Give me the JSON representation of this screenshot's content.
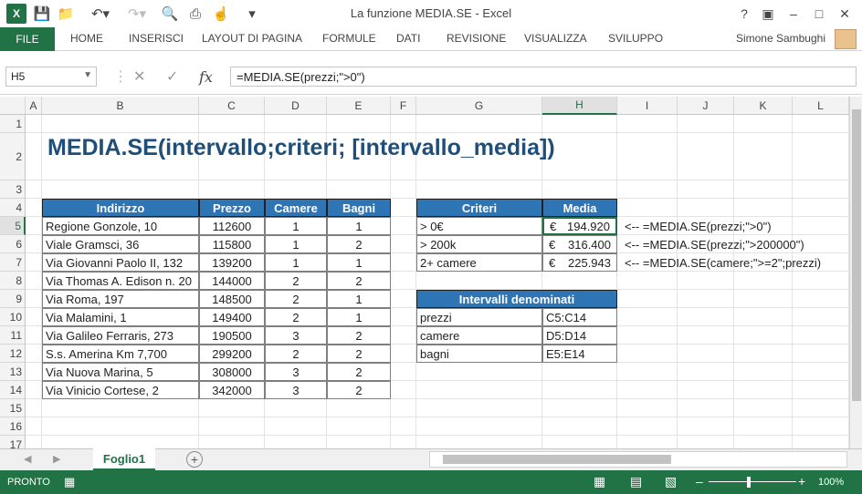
{
  "window": {
    "title": "La funzione MEDIA.SE - Excel",
    "app_icon": "X"
  },
  "ribbon": {
    "file": "FILE",
    "tabs": [
      "HOME",
      "INSERISCI",
      "LAYOUT DI PAGINA",
      "FORMULE",
      "DATI",
      "REVISIONE",
      "VISUALIZZA",
      "SVILUPPO"
    ],
    "user": "Simone Sambughi"
  },
  "formula_bar": {
    "name_box": "H5",
    "formula": "=MEDIA.SE(prezzi;\">0\")",
    "fx": "fx"
  },
  "columns": [
    "A",
    "B",
    "C",
    "D",
    "E",
    "F",
    "G",
    "H",
    "I",
    "J",
    "K",
    "L"
  ],
  "rows": [
    "1",
    "2",
    "3",
    "4",
    "5",
    "6",
    "7",
    "8",
    "9",
    "10",
    "11",
    "12",
    "13",
    "14",
    "15",
    "16",
    "17"
  ],
  "sheet": {
    "title": "MEDIA.SE(intervallo;criteri; [intervallo_media])",
    "table_headers": [
      "Indirizzo",
      "Prezzo",
      "Camere",
      "Bagni"
    ],
    "table_rows": [
      [
        "Regione Gonzole, 10",
        "112600",
        "1",
        "1"
      ],
      [
        "Viale Gramsci, 36",
        "115800",
        "1",
        "2"
      ],
      [
        "Via Giovanni Paolo II, 132",
        "139200",
        "1",
        "1"
      ],
      [
        "Via Thomas A. Edison n. 20",
        "144000",
        "2",
        "2"
      ],
      [
        "Via Roma, 197",
        "148500",
        "2",
        "1"
      ],
      [
        "Via Malamini, 1",
        "149400",
        "2",
        "1"
      ],
      [
        "Via Galileo Ferraris, 273",
        "190500",
        "3",
        "2"
      ],
      [
        "S.s. Amerina Km 7,700",
        "299200",
        "2",
        "2"
      ],
      [
        "Via Nuova Marina, 5",
        "308000",
        "3",
        "2"
      ],
      [
        "Via Vinicio Cortese, 2",
        "342000",
        "3",
        "2"
      ]
    ],
    "criteria_headers": [
      "Criteri",
      "Media"
    ],
    "criteria_rows": [
      {
        "label": "> 0€",
        "currency": "€",
        "value": "194.920",
        "note": "<-- =MEDIA.SE(prezzi;\">0\")"
      },
      {
        "label": "> 200k",
        "currency": "€",
        "value": "316.400",
        "note": "<-- =MEDIA.SE(prezzi;\">200000\")"
      },
      {
        "label": "2+ camere",
        "currency": "€",
        "value": "225.943",
        "note": "<-- =MEDIA.SE(camere;\">=2\";prezzi)"
      }
    ],
    "named_header": "Intervalli denominati",
    "named_rows": [
      [
        "prezzi",
        "C5:C14"
      ],
      [
        "camere",
        "D5:D14"
      ],
      [
        "bagni",
        "E5:E14"
      ]
    ]
  },
  "sheet_tab": "Foglio1",
  "status": {
    "ready": "PRONTO",
    "zoom": "100%"
  },
  "colors": {
    "accent": "#217346",
    "header_fill": "#2e75b6",
    "title": "#1f4e79"
  }
}
